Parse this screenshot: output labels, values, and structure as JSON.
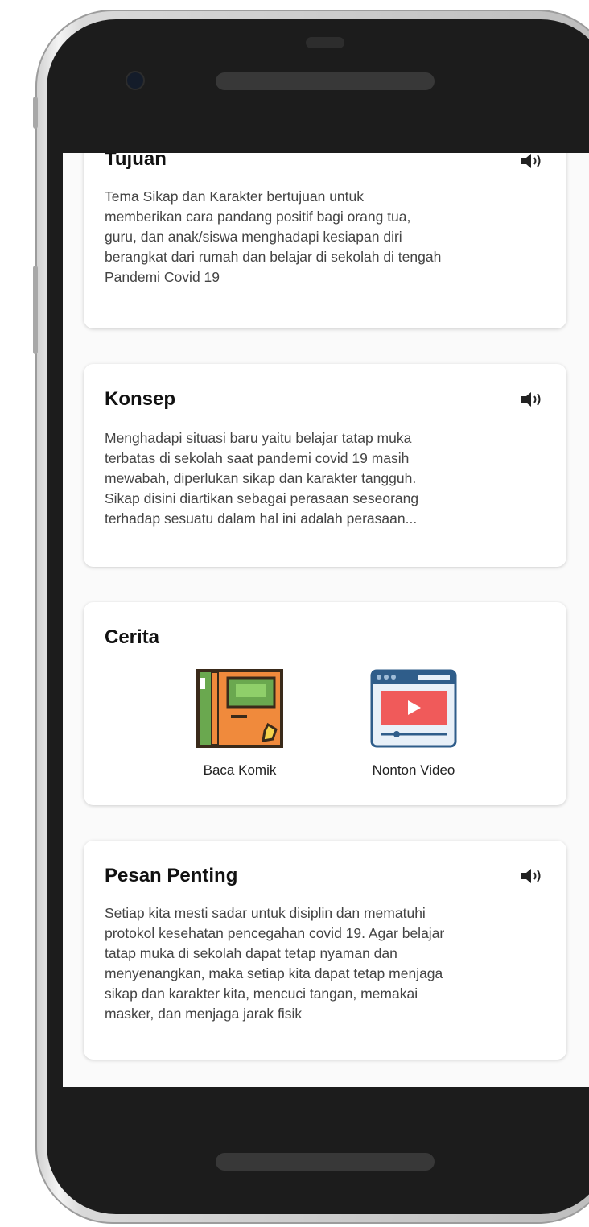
{
  "cards": {
    "tujuan": {
      "title": "Tujuan",
      "body": "Tema Sikap dan Karakter bertujuan untuk\nmemberikan cara pandang positif bagi orang tua,\nguru, dan anak/siswa menghadapi kesiapan diri\nberangkat dari rumah dan belajar di sekolah di tengah\nPandemi Covid 19",
      "icon": "speaker-icon"
    },
    "konsep": {
      "title": "Konsep",
      "body": "Menghadapi situasi baru yaitu belajar tatap muka\nterbatas di sekolah saat pandemi covid 19 masih\nmewabah, diperlukan sikap dan karakter tangguh.\nSikap disini diartikan sebagai perasaan seseorang\nterhadap sesuatu dalam hal ini adalah perasaan...",
      "icon": "speaker-icon"
    },
    "cerita": {
      "title": "Cerita",
      "items": [
        {
          "label": "Baca Komik",
          "icon": "comic-book-icon"
        },
        {
          "label": "Nonton Video",
          "icon": "video-player-icon"
        }
      ]
    },
    "pesan": {
      "title": "Pesan Penting",
      "body": "Setiap kita mesti sadar untuk disiplin dan mematuhi\nprotokol kesehatan pencegahan covid 19. Agar belajar\ntatap muka di sekolah dapat tetap nyaman dan\nmenyenangkan, maka setiap kita dapat tetap menjaga\nsikap dan karakter kita, mencuci tangan, memakai\nmasker, dan menjaga jarak fisik",
      "icon": "speaker-icon"
    }
  },
  "colors": {
    "phone_bezel": "#1c1c1c",
    "screen_bg": "#fafafa",
    "card_bg": "#ffffff",
    "title_text": "#111111",
    "body_text": "#444444",
    "comic_orange": "#f08a3c",
    "comic_green": "#6aa84f",
    "video_red": "#f05a5a",
    "video_frame": "#2f5d8a"
  }
}
